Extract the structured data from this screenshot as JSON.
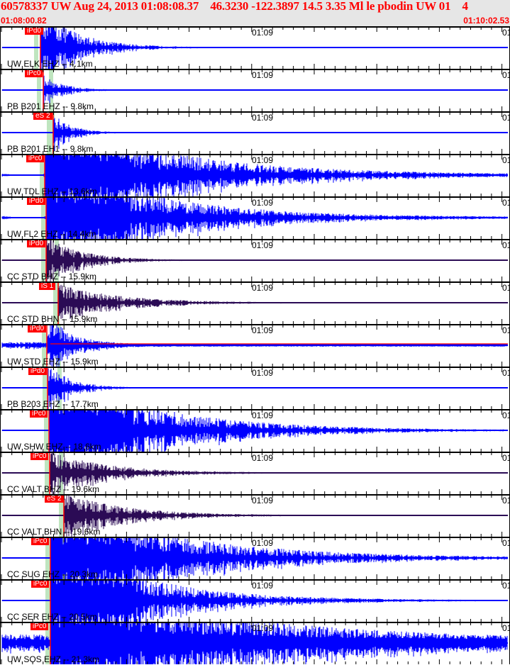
{
  "header": {
    "title": "60578337 UW Aug 24, 2013 01:08:08.37    46.3230 -122.3897 14.5 3.35 Ml le pbodin UW 01    4",
    "start_time": "01:08:00.82",
    "end_time": "01:10:02.53"
  },
  "time_ticks": [
    "01:09",
    "01"
  ],
  "colors": {
    "header_bg": "#e6e6e6",
    "title": "#ff0000",
    "trace_blue": "#0000ff",
    "trace_dark": "#2b0b55",
    "pick": "#ff0000",
    "window": "#bfe5bf"
  },
  "panels": [
    {
      "label": "UW ELK EHZ -- 4.1km",
      "pick": "iPd0"
    },
    {
      "label": "PB B201 EHZ -- 9.8km",
      "pick": "iPc0"
    },
    {
      "label": "PB B201 EH1 -- 9.8km",
      "pick": "eS 2"
    },
    {
      "label": "UW TDL EHZ -- 13.6km",
      "pick": "iPc0"
    },
    {
      "label": "UW FL2 EHZ -- 14.4km",
      "pick": "iPd0"
    },
    {
      "label": "CC STD BHZ -- 15.9km",
      "pick": "iPd0"
    },
    {
      "label": "CC STD BHN -- 15.9km",
      "pick": "iS 1"
    },
    {
      "label": "UW STD EHZ -- 15.9km",
      "pick": "iPd0"
    },
    {
      "label": "PB B203 EHZ -- 17.7km",
      "pick": "iPd0"
    },
    {
      "label": "UW SHW EHZ -- 18.6km",
      "pick": "iPc0"
    },
    {
      "label": "CC VALT BHZ -- 19.6km",
      "pick": "iPc0"
    },
    {
      "label": "CC VALT BHN -- 19.6km",
      "pick": "eS 2"
    },
    {
      "label": "CC SUG EHZ -- 20.3km",
      "pick": "iPc0"
    },
    {
      "label": "CC SER EHZ -- 20.5km",
      "pick": "iPc0"
    },
    {
      "label": "UW SOS EHZ -- 21.3km",
      "pick": "iPc0"
    }
  ]
}
